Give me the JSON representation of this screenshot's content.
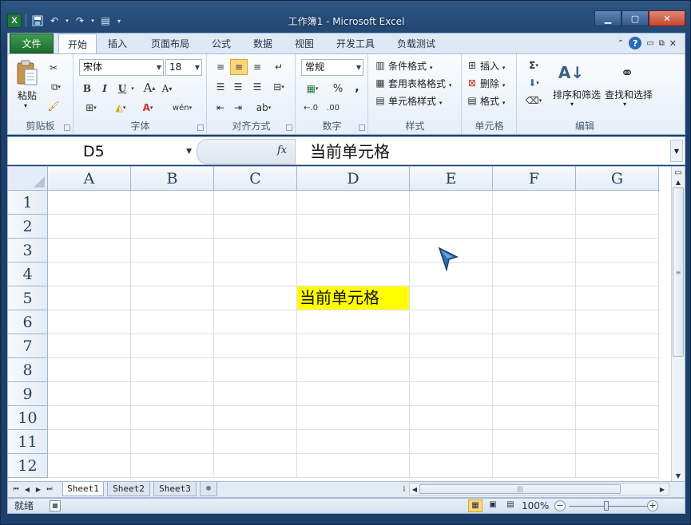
{
  "window": {
    "title": "工作簿1 - Microsoft Excel",
    "app_icon": "X"
  },
  "ribbon_tabs": [
    "文件",
    "开始",
    "插入",
    "页面布局",
    "公式",
    "数据",
    "视图",
    "开发工具",
    "负载测试"
  ],
  "clipboard": {
    "paste": "粘贴",
    "label": "剪贴板"
  },
  "font": {
    "name": "宋体",
    "size": "18",
    "bold": "B",
    "italic": "I",
    "underline": "U",
    "grow": "A",
    "shrink": "A",
    "label": "字体"
  },
  "alignment": {
    "label": "对齐方式"
  },
  "number": {
    "format": "常规",
    "percent": "%",
    "comma": ",",
    "label": "数字"
  },
  "styles": {
    "conditional": "条件格式",
    "table": "套用表格格式",
    "cell": "单元格样式",
    "label": "样式"
  },
  "cells": {
    "insert": "插入",
    "delete": "删除",
    "format": "格式",
    "label": "单元格"
  },
  "editing": {
    "sort": "排序和筛选",
    "find": "查找和选择",
    "label": "编辑"
  },
  "formula_bar": {
    "name_box": "D5",
    "fx": "fx",
    "content": "当前单元格"
  },
  "grid": {
    "columns": [
      "A",
      "B",
      "C",
      "D",
      "E",
      "F",
      "G"
    ],
    "rows": [
      "1",
      "2",
      "3",
      "4",
      "5",
      "6",
      "7",
      "8",
      "9",
      "10",
      "11",
      "12"
    ],
    "active_cell_text": "当前单元格",
    "highlight_color": "#ffff00"
  },
  "sheets": [
    "Sheet1",
    "Sheet2",
    "Sheet3"
  ],
  "status": {
    "mode": "就绪",
    "zoom": "100%"
  }
}
